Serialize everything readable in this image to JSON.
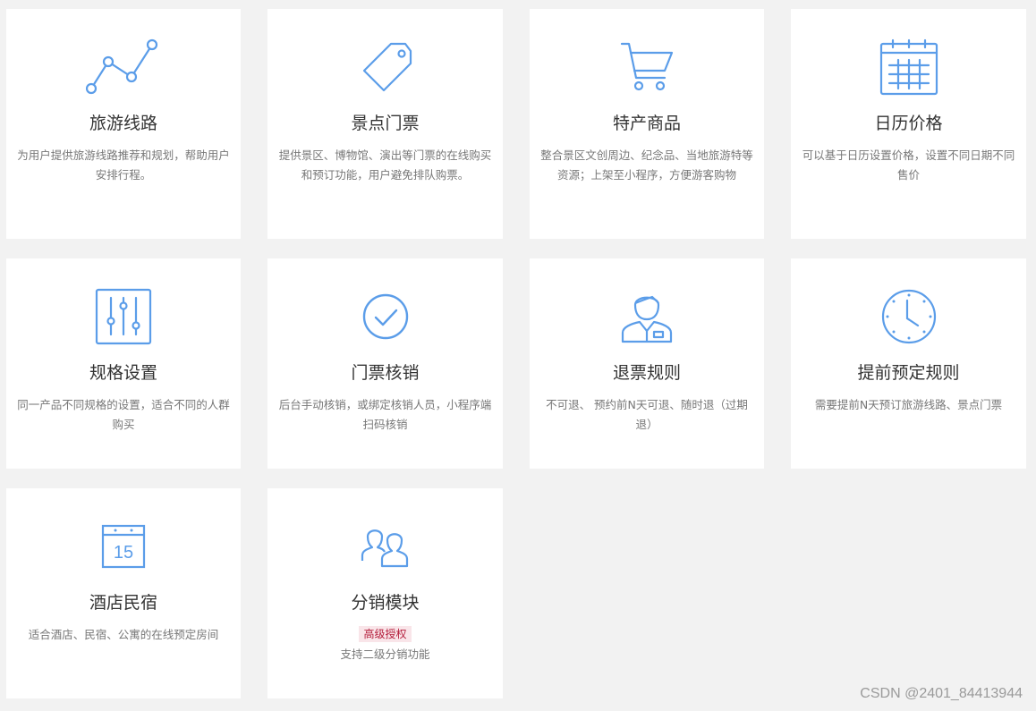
{
  "features": [
    {
      "title": "旅游线路",
      "desc": "为用户提供旅游线路推荐和规划，帮助用户安排行程。"
    },
    {
      "title": "景点门票",
      "desc": "提供景区、博物馆、演出等门票的在线购买和预订功能，用户避免排队购票。"
    },
    {
      "title": "特产商品",
      "desc": "整合景区文创周边、纪念品、当地旅游特等资源；上架至小程序，方便游客购物"
    },
    {
      "title": "日历价格",
      "desc": "可以基于日历设置价格，设置不同日期不同售价"
    },
    {
      "title": "规格设置",
      "desc": "同一产品不同规格的设置，适合不同的人群购买"
    },
    {
      "title": "门票核销",
      "desc": "后台手动核销，或绑定核销人员，小程序端扫码核销"
    },
    {
      "title": "退票规则",
      "desc": "不可退、 预约前N天可退、随时退（过期退）"
    },
    {
      "title": "提前预定规则",
      "desc": "需要提前N天预订旅游线路、景点门票"
    },
    {
      "title": "酒店民宿",
      "desc": "适合酒店、民宿、公寓的在线预定房间",
      "icon_text": "15"
    },
    {
      "title": "分销模块",
      "badge": "高级授权",
      "desc": "支持二级分销功能"
    }
  ],
  "icons": [
    "line-chart-icon",
    "tag-icon",
    "shopping-cart-icon",
    "calendar-grid-icon",
    "sliders-icon",
    "check-circle-icon",
    "agent-person-icon",
    "clock-icon",
    "calendar-15-icon",
    "users-icon"
  ],
  "colors": {
    "icon": "#5b9de9",
    "badge_bg": "#f9e5e9",
    "badge_text": "#b41e3c",
    "page_bg": "#f2f2f2"
  },
  "watermark": "CSDN @2401_84413944"
}
